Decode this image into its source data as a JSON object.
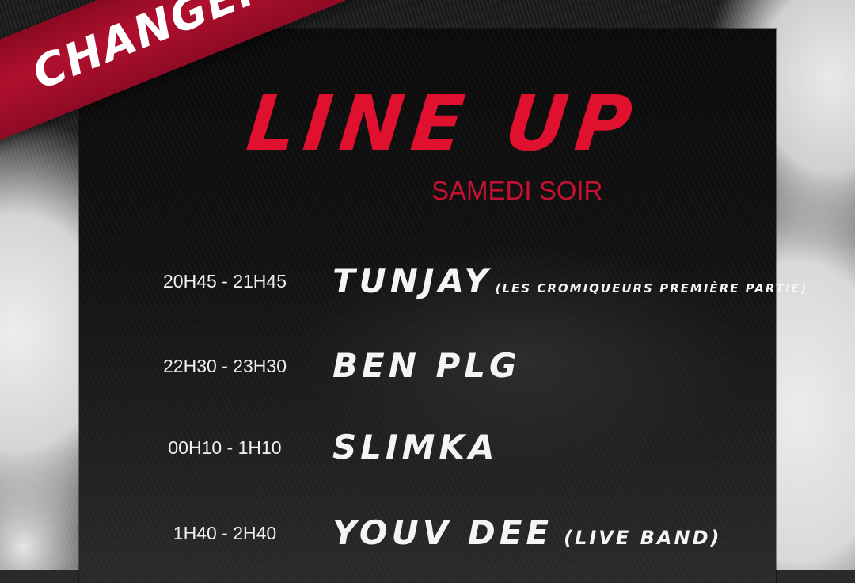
{
  "banner": {
    "text": "CHANGEMENT"
  },
  "header": {
    "title": "LINE UP",
    "subtitle": "SAMEDI SOIR"
  },
  "lineup": [
    {
      "time": "20H45 - 21H45",
      "artist": "TUNJAY",
      "note": "(LES CROMIQUEURS PREMIÈRE PARTIE)"
    },
    {
      "time": "22H30 - 23H30",
      "artist": "BEN PLG",
      "note": ""
    },
    {
      "time": "00H10 - 1H10",
      "artist": "SLIMKA",
      "note": ""
    },
    {
      "time": "1H40 - 2H40",
      "artist": "YOUV DEE",
      "note": "(LIVE BAND)"
    }
  ],
  "colors": {
    "accent": "#e0102f",
    "banner": "#b0102e",
    "panel": "#0b0b0b",
    "text": "#f4f4f4"
  }
}
